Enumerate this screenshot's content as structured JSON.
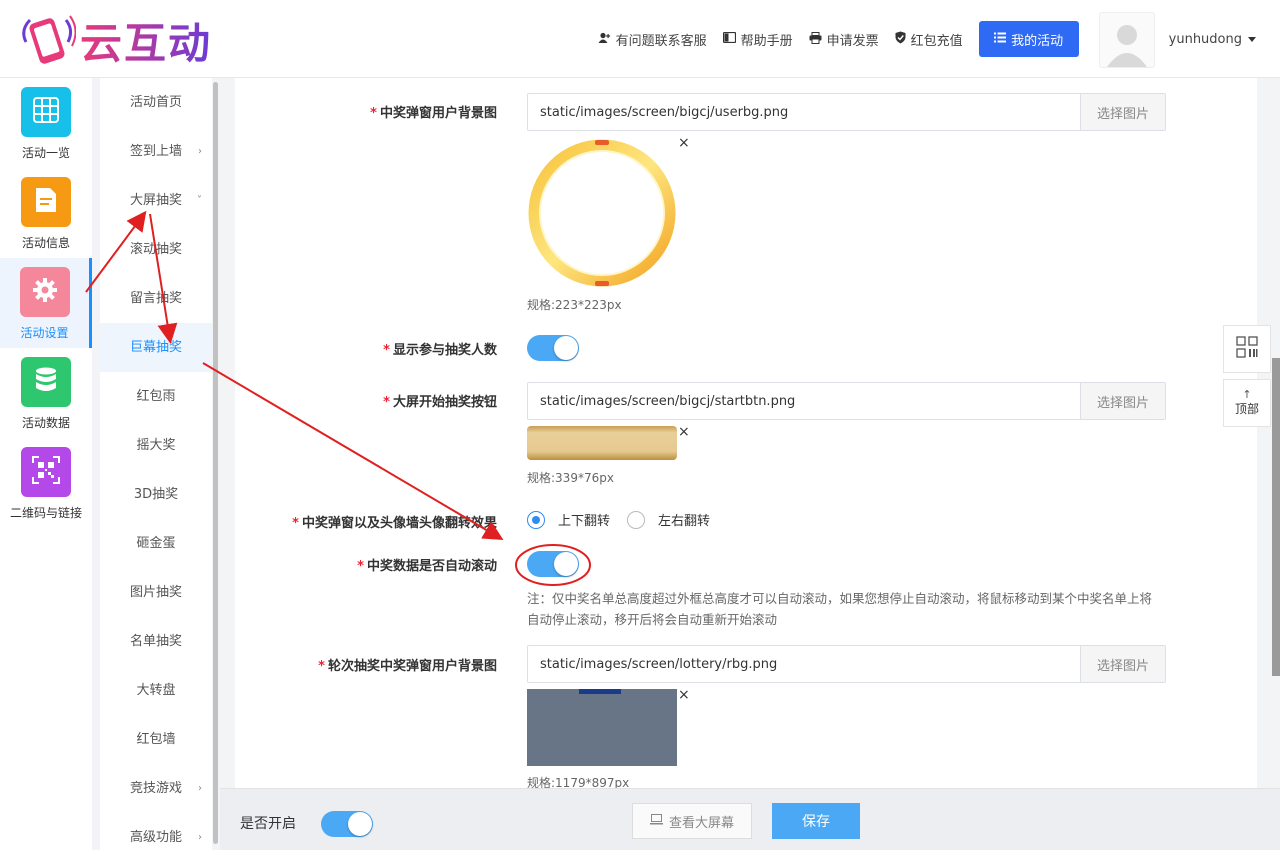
{
  "brand": {
    "name": "云互动"
  },
  "header": {
    "nav": [
      {
        "icon": "user-plus-icon",
        "label": "有问题联系客服"
      },
      {
        "icon": "book-icon",
        "label": "帮助手册"
      },
      {
        "icon": "printer-icon",
        "label": "申请发票"
      },
      {
        "icon": "shield-check-icon",
        "label": "红包充值"
      }
    ],
    "my_activity": "我的活动",
    "username": "yunhudong"
  },
  "iconbar": {
    "items": [
      {
        "label": "活动一览",
        "icon": "grid-icon",
        "color": "#16c0e8"
      },
      {
        "label": "活动信息",
        "icon": "document-icon",
        "color": "#f59a12"
      },
      {
        "label": "活动设置",
        "icon": "gear-icon",
        "color": "#f5879a"
      },
      {
        "label": "活动数据",
        "icon": "database-icon",
        "color": "#2ec76f"
      },
      {
        "label": "二维码与链接",
        "icon": "qrcode-icon",
        "color": "#b548e8"
      }
    ]
  },
  "submenu": {
    "items": [
      {
        "label": "活动首页",
        "arrow": ""
      },
      {
        "label": "签到上墙",
        "arrow": "›"
      },
      {
        "label": "大屏抽奖",
        "arrow": "˅"
      },
      {
        "label": "滚动抽奖",
        "arrow": ""
      },
      {
        "label": "留言抽奖",
        "arrow": ""
      },
      {
        "label": "巨幕抽奖",
        "arrow": ""
      },
      {
        "label": "红包雨",
        "arrow": ""
      },
      {
        "label": "摇大奖",
        "arrow": ""
      },
      {
        "label": "3D抽奖",
        "arrow": ""
      },
      {
        "label": "砸金蛋",
        "arrow": ""
      },
      {
        "label": "图片抽奖",
        "arrow": ""
      },
      {
        "label": "名单抽奖",
        "arrow": ""
      },
      {
        "label": "大转盘",
        "arrow": ""
      },
      {
        "label": "红包墙",
        "arrow": ""
      },
      {
        "label": "竞技游戏",
        "arrow": "›"
      },
      {
        "label": "高级功能",
        "arrow": "›"
      }
    ]
  },
  "form": {
    "star": "*",
    "pick_label": "选择图片",
    "close": "×",
    "user_bg": {
      "label": "中奖弹窗用户背景图",
      "value": "static/images/screen/bigcj/userbg.png",
      "spec": "规格:223*223px"
    },
    "show_count": {
      "label": "显示参与抽奖人数",
      "on": true
    },
    "start_btn": {
      "label": "大屏开始抽奖按钮",
      "value": "static/images/screen/bigcj/startbtn.png",
      "spec": "规格:339*76px"
    },
    "flip_effect": {
      "label": "中奖弹窗以及头像墙头像翻转效果",
      "options": [
        "上下翻转",
        "左右翻转"
      ],
      "selected": "上下翻转"
    },
    "auto_scroll": {
      "label": "中奖数据是否自动滚动",
      "on": true,
      "note": "注：仅中奖名单总高度超过外框总高度才可以自动滚动，如果您想停止自动滚动，将鼠标移动到某个中奖名单上将自动停止滚动，移开后将会自动重新开始滚动"
    },
    "round_bg": {
      "label": "轮次抽奖中奖弹窗用户背景图",
      "value": "static/images/screen/lottery/rbg.png",
      "spec": "规格:1179*897px"
    }
  },
  "bottom": {
    "enabled_label": "是否开启",
    "enabled": true,
    "view_screen": "查看大屏幕",
    "save": "保存"
  },
  "float": {
    "qr_icon": "qrcode-icon",
    "top_label": "顶部",
    "top_icon": "arrow-up-icon"
  }
}
